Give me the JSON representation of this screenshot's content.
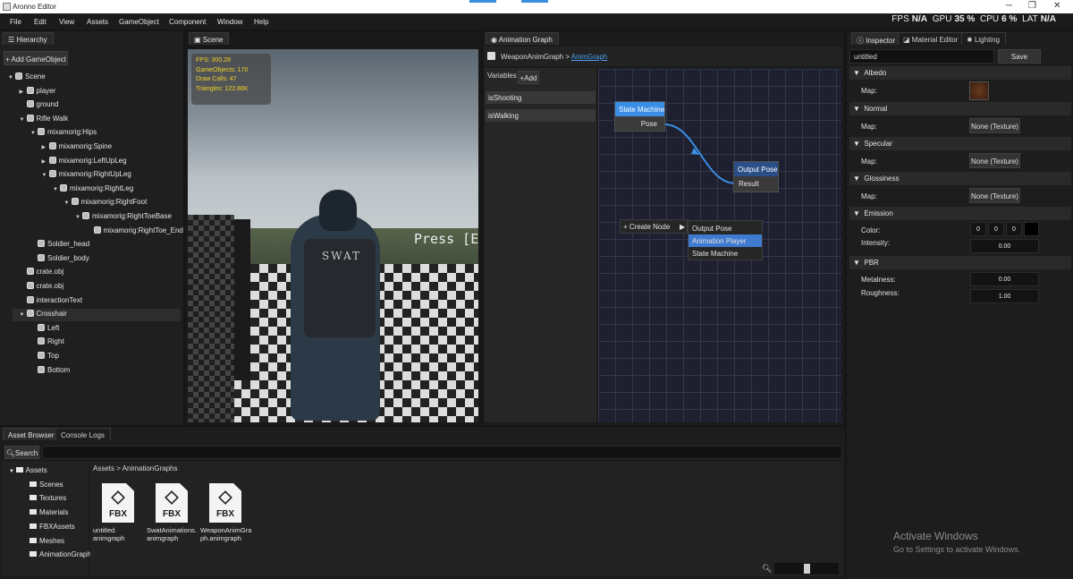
{
  "window": {
    "title": "Aronno Editor",
    "minimize": "─",
    "maximize": "❐",
    "close": "✕"
  },
  "menu": [
    "File",
    "Edit",
    "View",
    "Assets",
    "GameObject",
    "Component",
    "Window",
    "Help"
  ],
  "stats": {
    "fps_label": "FPS",
    "fps_value": "N/A",
    "gpu_label": "GPU",
    "gpu_value": "35 %",
    "cpu_label": "CPU",
    "cpu_value": "6 %",
    "lat_label": "LAT",
    "lat_value": "N/A"
  },
  "hierarchy": {
    "tab": "Hierarchy",
    "add_button": "Add GameObject",
    "items": [
      {
        "label": "Scene",
        "depth": 0,
        "arrow": "▼"
      },
      {
        "label": "player",
        "depth": 1,
        "arrow": "▶"
      },
      {
        "label": "ground",
        "depth": 1,
        "arrow": ""
      },
      {
        "label": "Rifle Walk",
        "depth": 1,
        "arrow": "▼"
      },
      {
        "label": "mixamorig:Hips",
        "depth": 2,
        "arrow": "▼"
      },
      {
        "label": "mixamorig:Spine",
        "depth": 3,
        "arrow": "▶"
      },
      {
        "label": "mixamorig:LeftUpLeg",
        "depth": 3,
        "arrow": "▶"
      },
      {
        "label": "mixamorig:RightUpLeg",
        "depth": 3,
        "arrow": "▼"
      },
      {
        "label": "mixamorig:RightLeg",
        "depth": 4,
        "arrow": "▼"
      },
      {
        "label": "mixamorig:RightFoot",
        "depth": 5,
        "arrow": "▼"
      },
      {
        "label": "mixamorig:RightToeBase",
        "depth": 6,
        "arrow": "▼"
      },
      {
        "label": "mixamorig:RightToe_End",
        "depth": 7,
        "arrow": ""
      },
      {
        "label": "Soldier_head",
        "depth": 2,
        "arrow": ""
      },
      {
        "label": "Soldier_body",
        "depth": 2,
        "arrow": ""
      },
      {
        "label": "crate.obj",
        "depth": 1,
        "arrow": ""
      },
      {
        "label": "crate.obj",
        "depth": 1,
        "arrow": ""
      },
      {
        "label": "interactionText",
        "depth": 1,
        "arrow": ""
      },
      {
        "label": "Crosshair",
        "depth": 1,
        "arrow": "▼",
        "selected": true
      },
      {
        "label": "Left",
        "depth": 2,
        "arrow": ""
      },
      {
        "label": "Right",
        "depth": 2,
        "arrow": ""
      },
      {
        "label": "Top",
        "depth": 2,
        "arrow": ""
      },
      {
        "label": "Bottom",
        "depth": 2,
        "arrow": ""
      }
    ]
  },
  "scene": {
    "tab": "Scene",
    "overlay": {
      "fps": "FPS: 300.28",
      "gameobjects": "GameObjects: 170",
      "draw_calls": "Draw Calls: 47",
      "triangles": "Triangles: 122.88K"
    },
    "press_text": "Press [E]",
    "vest_text": "SWAT"
  },
  "animation_graph": {
    "tab": "Animation Graph",
    "breadcrumb_prefix": "WeaponAnimGraph > ",
    "breadcrumb_link": "AnimGraph",
    "variables_label": "Variables",
    "add_button": "+Add",
    "variables": [
      "isShooting",
      "isWalking"
    ],
    "nodes": {
      "state_machine": {
        "title": "State Machine",
        "pin": "Pose"
      },
      "output_pose": {
        "title": "Output Pose",
        "pin": "Result"
      }
    },
    "context_menu": {
      "create_node": "Create Node",
      "arrow": "▶",
      "items": [
        "Output Pose",
        "Animation Player",
        "State Machine"
      ],
      "selected_index": 1
    },
    "colors": {
      "state_machine_header": "#3a8ee6",
      "output_pose_header": "#2a4f86",
      "link": "#3a8ee6"
    }
  },
  "inspector": {
    "tabs": [
      "Inspector",
      "Material Editor",
      "Lighting"
    ],
    "name_value": "untitled",
    "save_button": "Save",
    "sections": [
      {
        "title": "Albedo",
        "map_label": "Map:",
        "map_value": ""
      },
      {
        "title": "Normal",
        "map_label": "Map:",
        "map_value": "None (Texture)"
      },
      {
        "title": "Specular",
        "map_label": "Map:",
        "map_value": "None (Texture)"
      },
      {
        "title": "Glossiness",
        "map_label": "Map:",
        "map_value": "None (Texture)"
      }
    ],
    "emission": {
      "title": "Emission",
      "color_label": "Color:",
      "color_values": [
        "0",
        "0",
        "0"
      ],
      "intensity_label": "Intensity:",
      "intensity_value": "0.00"
    },
    "pbr": {
      "title": "PBR",
      "metalness_label": "Metalness:",
      "metalness_value": "0.00",
      "roughness_label": "Roughness:",
      "roughness_value": "1.00"
    }
  },
  "asset_browser": {
    "tabs": [
      "Asset Browser",
      "Console Logs"
    ],
    "search_button": "Search",
    "folders": [
      "Assets",
      "Scenes",
      "Textures",
      "Materials",
      "FBXAssets",
      "Meshes",
      "AnimationGraph"
    ],
    "path": "Assets > AnimationGraphs",
    "assets": [
      {
        "badge": "FBX",
        "name1": "untitled.",
        "name2": "animgraph"
      },
      {
        "badge": "FBX",
        "name1": "SwatAnimations.",
        "name2": "animgraph"
      },
      {
        "badge": "FBX",
        "name1": "WeaponAnimGra",
        "name2": "ph.animgraph"
      }
    ],
    "zoom_fraction": 0.5
  },
  "watermark": {
    "line1": "Activate Windows",
    "line2": "Go to Settings to activate Windows."
  }
}
